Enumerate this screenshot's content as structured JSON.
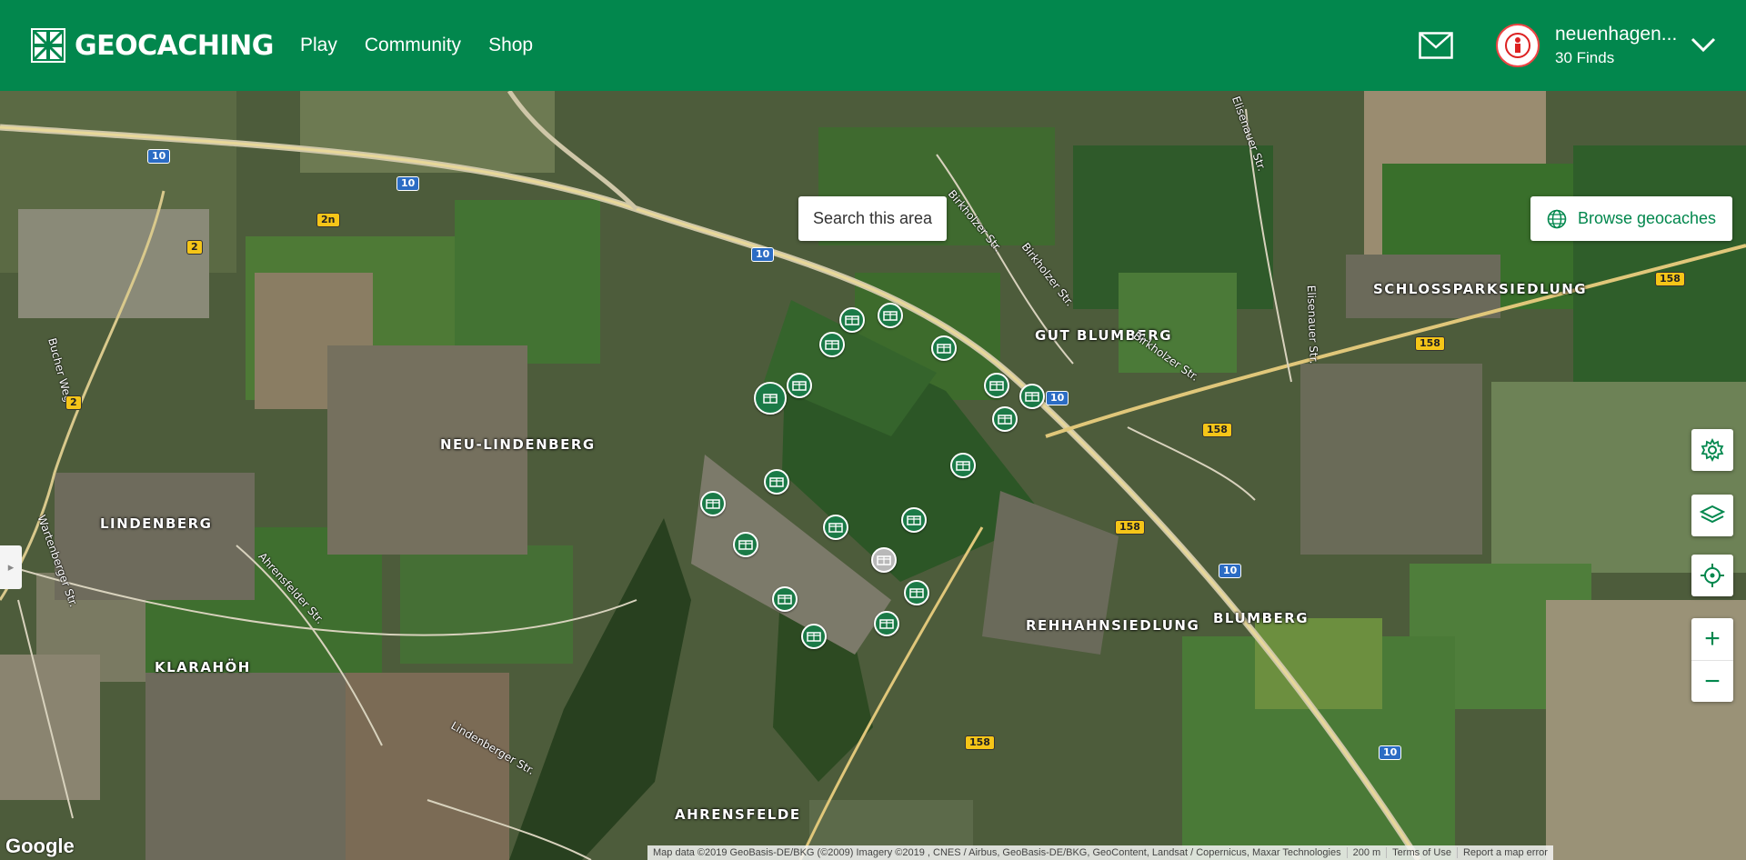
{
  "header": {
    "logo_text": "GEOCACHING",
    "nav": [
      "Play",
      "Community",
      "Shop"
    ],
    "user_name": "neuenhagen...",
    "user_finds": "30 Finds"
  },
  "map": {
    "search_area_label": "Search this area",
    "browse_label": "Browse geocaches",
    "zoom_in": "+",
    "zoom_out": "−",
    "place_labels": [
      "SCHLOSSPARKSIEDLUNG",
      "GUT BLUMBERG",
      "NEU-LINDENBERG",
      "LINDENBERG",
      "REHHAHNSIEDLUNG",
      "BLUMBERG",
      "KLARAHÖH",
      "AHRENSFELDE"
    ],
    "street_labels": [
      "Birkholzer Str.",
      "Birkholzer Str.",
      "Birkholzer Str.",
      "Elisenauer Str.",
      "Elisenauer Str.",
      "Bucher Weg",
      "Ahrensfelder Str.",
      "Wartenberger Str.",
      "Lindenberger Str."
    ],
    "road_shields": [
      "10",
      "10",
      "10",
      "10",
      "10",
      "10",
      "2n",
      "2",
      "2",
      "158",
      "158",
      "158",
      "158",
      "158"
    ],
    "google_logo": "Google",
    "attribution": {
      "map_data": "Map data ©2019 GeoBasis-DE/BKG (©2009) Imagery ©2019 , CNES / Airbus, GeoBasis-DE/BKG, GeoContent, Landsat / Copernicus, Maxar Technologies",
      "scale": "200 m",
      "terms": "Terms of Use",
      "report": "Report a map error"
    }
  },
  "colors": {
    "brand": "#02874d",
    "cache": "#1b7a47",
    "cache_found": "#b8b8b8"
  },
  "icons": [
    "geocaching-logo-icon",
    "mail-icon",
    "chevron-down-icon",
    "globe-icon",
    "gear-icon",
    "layers-icon",
    "locate-icon",
    "cache-icon"
  ]
}
